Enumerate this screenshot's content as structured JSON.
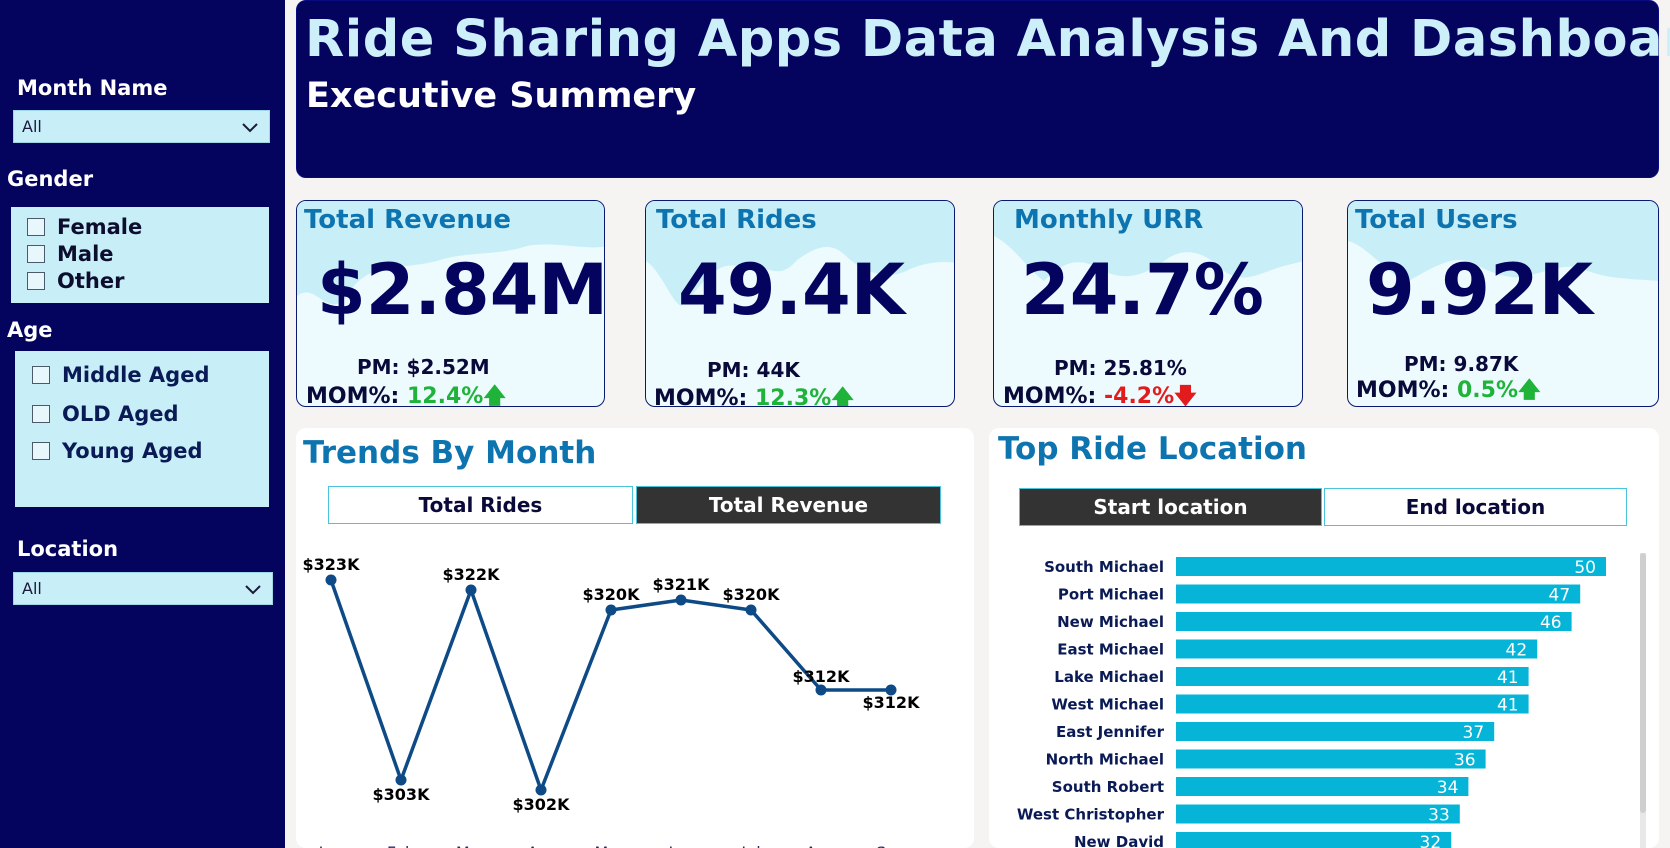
{
  "sidebar": {
    "month_label": "Month Name",
    "month_value": "All",
    "gender_label": "Gender",
    "gender_options": [
      "Female",
      "Male",
      "Other"
    ],
    "age_label": "Age",
    "age_options": [
      "Middle Aged",
      "OLD Aged",
      "Young Aged"
    ],
    "location_label": "Location",
    "location_value": "All"
  },
  "header": {
    "title": "Ride Sharing Apps Data Analysis And Dashboard",
    "subtitle": "Executive Summery"
  },
  "kpis": [
    {
      "title": "Total Revenue",
      "value": "$2.84M",
      "pm_label": "PM:",
      "pm_value": "$2.52M",
      "mom_label": "MOM%:",
      "mom_value": "12.4%",
      "trend": "up"
    },
    {
      "title": "Total Rides",
      "value": "49.4K",
      "pm_label": "PM:",
      "pm_value": "44K",
      "mom_label": "MOM%:",
      "mom_value": "12.3%",
      "trend": "up"
    },
    {
      "title": "Monthly URR",
      "value": "24.7%",
      "pm_label": "PM:",
      "pm_value": "25.81%",
      "mom_label": "MOM%:",
      "mom_value": "-4.2%",
      "trend": "down"
    },
    {
      "title": "Total Users",
      "value": "9.92K",
      "pm_label": "PM:",
      "pm_value": "9.87K",
      "mom_label": "MOM%:",
      "mom_value": "0.5%",
      "trend": "up"
    }
  ],
  "colors": {
    "navy": "#04045e",
    "accent": "#0e74b0",
    "light": "#c8eff8",
    "bar": "#06b4d8",
    "line": "#0d4a86",
    "up": "#1fb33a",
    "down": "#e21c1c"
  },
  "trends": {
    "title": "Trends By Month",
    "tabs": [
      "Total Rides",
      "Total Revenue"
    ],
    "active_tab": "Total Revenue"
  },
  "top_location": {
    "title": "Top Ride Location",
    "tabs": [
      "Start location",
      "End location"
    ],
    "active_tab": "Start location"
  },
  "chart_data": [
    {
      "type": "line",
      "title": "",
      "x": [
        "Jan",
        "Feb",
        "Mar",
        "Apr",
        "May",
        "Jun",
        "Jul",
        "Aug",
        "Sep"
      ],
      "values": [
        323,
        303,
        322,
        302,
        320,
        321,
        320,
        312,
        312
      ],
      "data_labels": [
        "$323K",
        "$303K",
        "$322K",
        "$302K",
        "$320K",
        "$321K",
        "$320K",
        "$312K",
        "$312K"
      ],
      "unit": "$K",
      "ylim": [
        300,
        324
      ],
      "grid": false
    },
    {
      "type": "bar",
      "orientation": "horizontal",
      "title": "",
      "categories": [
        "South Michael",
        "Port Michael",
        "New Michael",
        "East Michael",
        "Lake Michael",
        "West Michael",
        "East Jennifer",
        "North Michael",
        "South Robert",
        "West Christopher",
        "New David"
      ],
      "values": [
        50,
        47,
        46,
        42,
        41,
        41,
        37,
        36,
        34,
        33,
        32
      ],
      "xlim": [
        0,
        50
      ],
      "grid": false
    }
  ]
}
